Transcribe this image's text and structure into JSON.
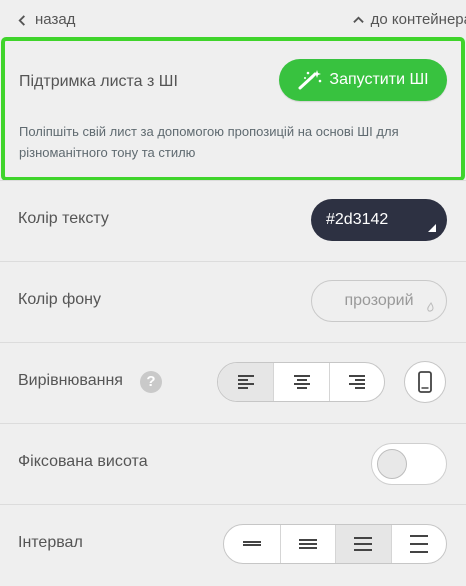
{
  "nav": {
    "back_label": "назад",
    "up_label": "до контейнера"
  },
  "ai_panel": {
    "title": "Підтримка листа з ШІ",
    "button_label": "Запустити ШІ",
    "description": "Поліпшіть свій лист за допомогою пропозицій на основі ШІ для різноманітного тону та стилю",
    "highlight_color": "#3fd42b",
    "button_color": "#38c23f"
  },
  "text_color": {
    "label": "Колір тексту",
    "value": "#2d3142"
  },
  "bg_color": {
    "label": "Колір фону",
    "value": "прозорий"
  },
  "alignment": {
    "label": "Вирівнювання",
    "help": "?",
    "options": [
      "align-left-icon",
      "align-center-icon",
      "align-right-icon"
    ],
    "selected": "left",
    "mobile_icon": "mobile-phone-icon"
  },
  "fixed_height": {
    "label": "Фіксована висота",
    "enabled": false
  },
  "spacing": {
    "label": "Інтервал",
    "options": [
      "spacing-compact-icon",
      "spacing-small-icon",
      "spacing-medium-icon",
      "spacing-large-icon"
    ],
    "selected": "medium"
  }
}
